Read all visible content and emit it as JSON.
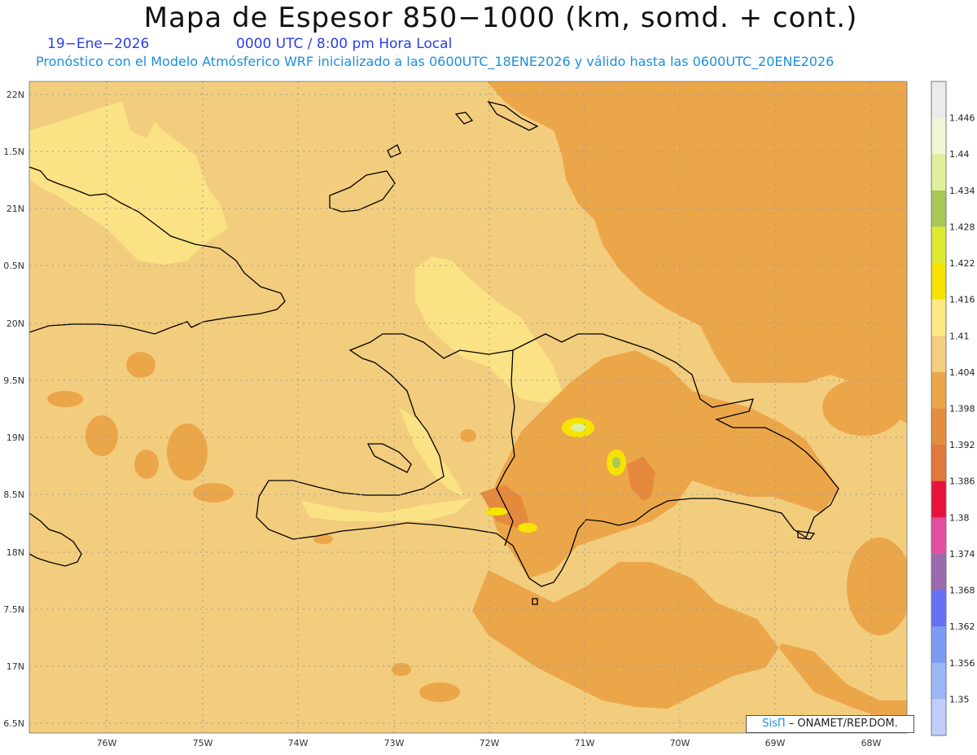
{
  "header": {
    "title": "Mapa de Espesor 850−1000 (km, somd. + cont.)",
    "date": "19−Ene−2026",
    "time": "0000 UTC / 8:00 pm Hora Local",
    "forecast_line": "Pronóstico con el Modelo Atmósferico WRF inicializado a las 0600UTC_18ENE2026 y válido hasta las  0600UTC_20ENE2026"
  },
  "map": {
    "lat_labels": [
      "22N",
      "1.5N",
      "21N",
      "0.5N",
      "20N",
      "9.5N",
      "19N",
      "8.5N",
      "18N",
      "7.5N",
      "17N",
      "6.5N"
    ],
    "lon_labels": [
      "76W",
      "75W",
      "74W",
      "73W",
      "72W",
      "71W",
      "70W",
      "69W",
      "68W"
    ],
    "colors": {
      "ocean_base": "#f3cd7e",
      "land_light": "#fbe285",
      "warm_area": "#eca64a",
      "deep_area": "#e58a3c",
      "coastline": "#000000",
      "grid": "#9a9a9a"
    }
  },
  "colorbar": {
    "labels": [
      "1.446",
      "1.44",
      "1.434",
      "1.428",
      "1.422",
      "1.416",
      "1.41",
      "1.404",
      "1.398",
      "1.392",
      "1.386",
      "1.38",
      "1.374",
      "1.368",
      "1.362",
      "1.356",
      "1.35"
    ],
    "colors": [
      "#ebebeb",
      "#f3f6d6",
      "#e0f09a",
      "#a8c858",
      "#dcea34",
      "#f6e400",
      "#fde983",
      "#f3ce7e",
      "#eca64a",
      "#e58d3e",
      "#e0793a",
      "#e8133c",
      "#e2509f",
      "#9a6aac",
      "#6670f5",
      "#7d9bf5",
      "#9ab7f7",
      "#c1cefa"
    ]
  },
  "credit": {
    "brand": "SisΠ",
    "text": "– ONAMET/REP.DOM."
  }
}
